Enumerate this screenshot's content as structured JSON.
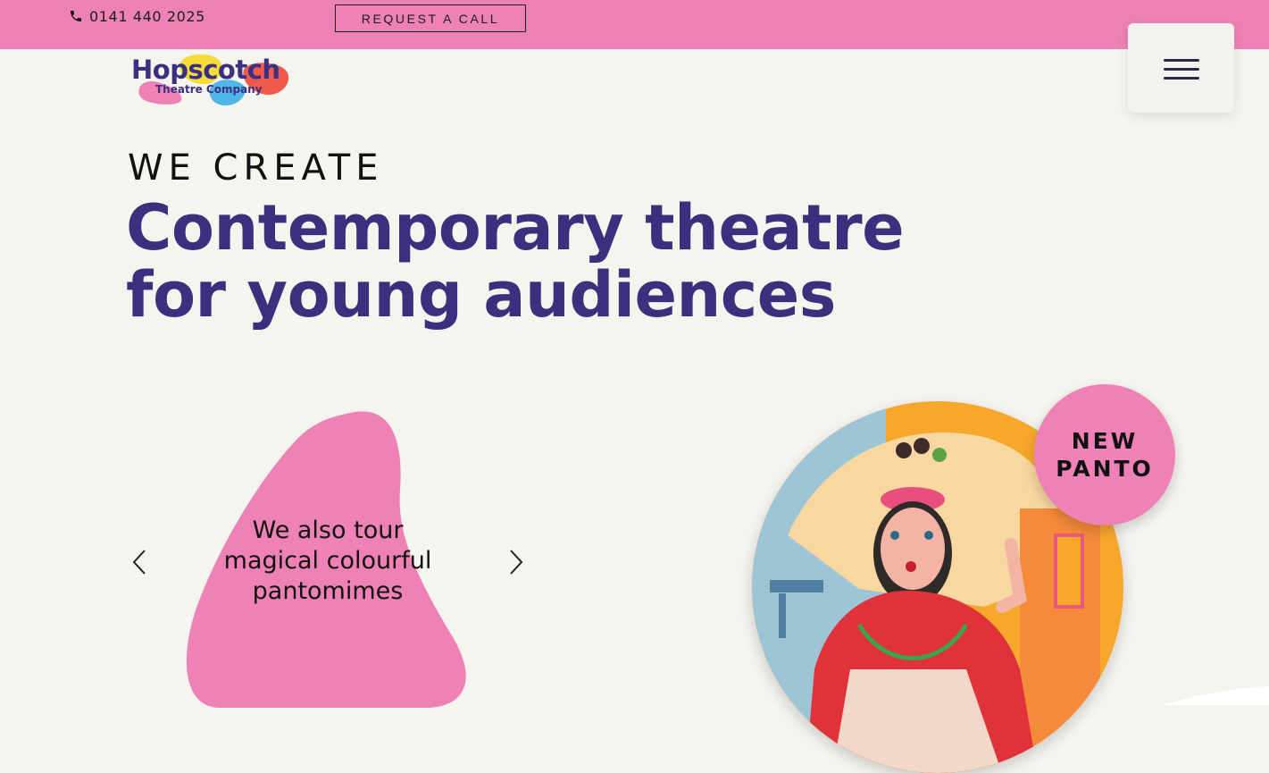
{
  "topbar": {
    "phone_icon": "phone-icon",
    "phone": "0141 440 2025",
    "request_label": "REQUEST A CALL",
    "background_color": "#ee82b6"
  },
  "header": {
    "logo_text": "Hopscotch",
    "logo_subtext": "Theatre Company",
    "menu_icon": "hamburger-menu-icon"
  },
  "hero": {
    "eyebrow": "WE CREATE",
    "headline_line1": "Contemporary theatre",
    "headline_line2": "for young audiences",
    "headline_color": "#3d2f7e"
  },
  "slider": {
    "slide_text_line1": "We also tour",
    "slide_text_line2": "magical colourful",
    "slide_text_line3": "pantomimes",
    "prev_icon": "chevron-left-icon",
    "next_icon": "chevron-right-icon",
    "blob_color": "#ee82b6"
  },
  "badge": {
    "line1": "NEW",
    "line2": "PANTO",
    "color": "#ee82b6"
  }
}
